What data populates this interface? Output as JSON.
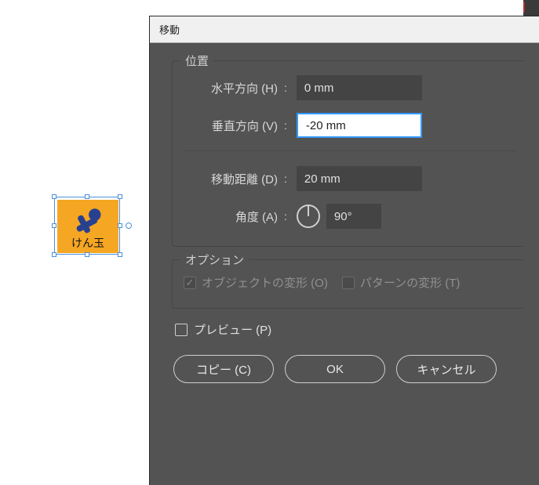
{
  "dialog": {
    "title": "移動",
    "groups": {
      "position": {
        "legend": "位置",
        "horizontal": {
          "label": "水平方向 (H)",
          "value": "0 mm"
        },
        "vertical": {
          "label": "垂直方向 (V)",
          "value": "-20 mm"
        }
      },
      "distance": {
        "label": "移動距離 (D)",
        "value": "20 mm"
      },
      "angle": {
        "label": "角度 (A)",
        "value": "90°"
      },
      "options": {
        "legend": "オプション",
        "transform_objects": {
          "label": "オブジェクトの変形 (O)",
          "checked": true
        },
        "transform_patterns": {
          "label": "パターンの変形 (T)",
          "checked": false
        }
      }
    },
    "preview": {
      "label": "プレビュー (P)",
      "checked": false
    },
    "buttons": {
      "copy": "コピー (C)",
      "ok": "OK",
      "cancel": "キャンセル"
    }
  },
  "canvas": {
    "object_label": "けん玉"
  }
}
